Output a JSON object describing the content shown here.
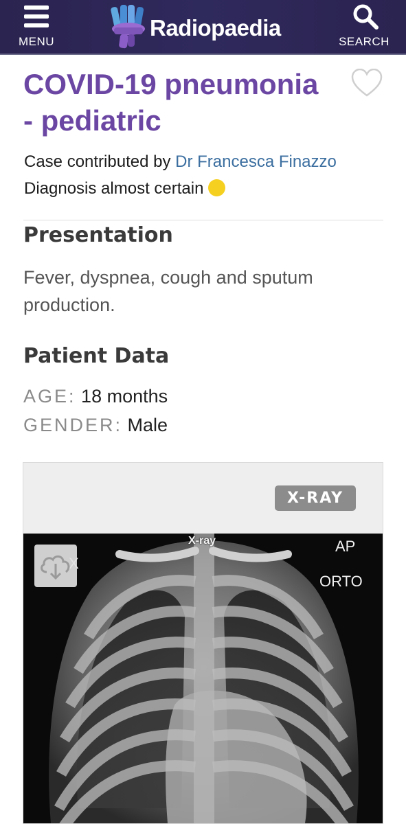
{
  "header": {
    "menu_label": "MENU",
    "logo_text": "Radiopaedia",
    "search_label": "SEARCH",
    "colors": {
      "background": "#2b2350",
      "text": "#ffffff"
    }
  },
  "case": {
    "title_line1": "COVID-19 pneumonia",
    "title_line2": "- pediatric",
    "title_color": "#6b47a3",
    "contributed_prefix": "Case contributed by",
    "contributor": "Dr Francesca Finazzo",
    "diagnosis": "Diagnosis almost certain",
    "diagnosis_indicator_color": "#f5d020"
  },
  "presentation": {
    "heading": "Presentation",
    "text": "Fever, dyspnea, cough and sputum production."
  },
  "patient_data": {
    "heading": "Patient Data",
    "age_label": "AGE:",
    "age_value": "18 months",
    "gender_label": "GENDER:",
    "gender_value": "Male"
  },
  "study": {
    "modality": "X-RAY",
    "image_labels": {
      "top": "X-ray",
      "ap": "AP",
      "orto": "ORTO",
      "side": "X"
    },
    "icons": [
      "download-icon"
    ]
  },
  "icons": [
    "menu-icon",
    "search-icon",
    "heart-icon",
    "radiopaedia-logo-icon",
    "diagnosis-certainty-dot-icon"
  ]
}
